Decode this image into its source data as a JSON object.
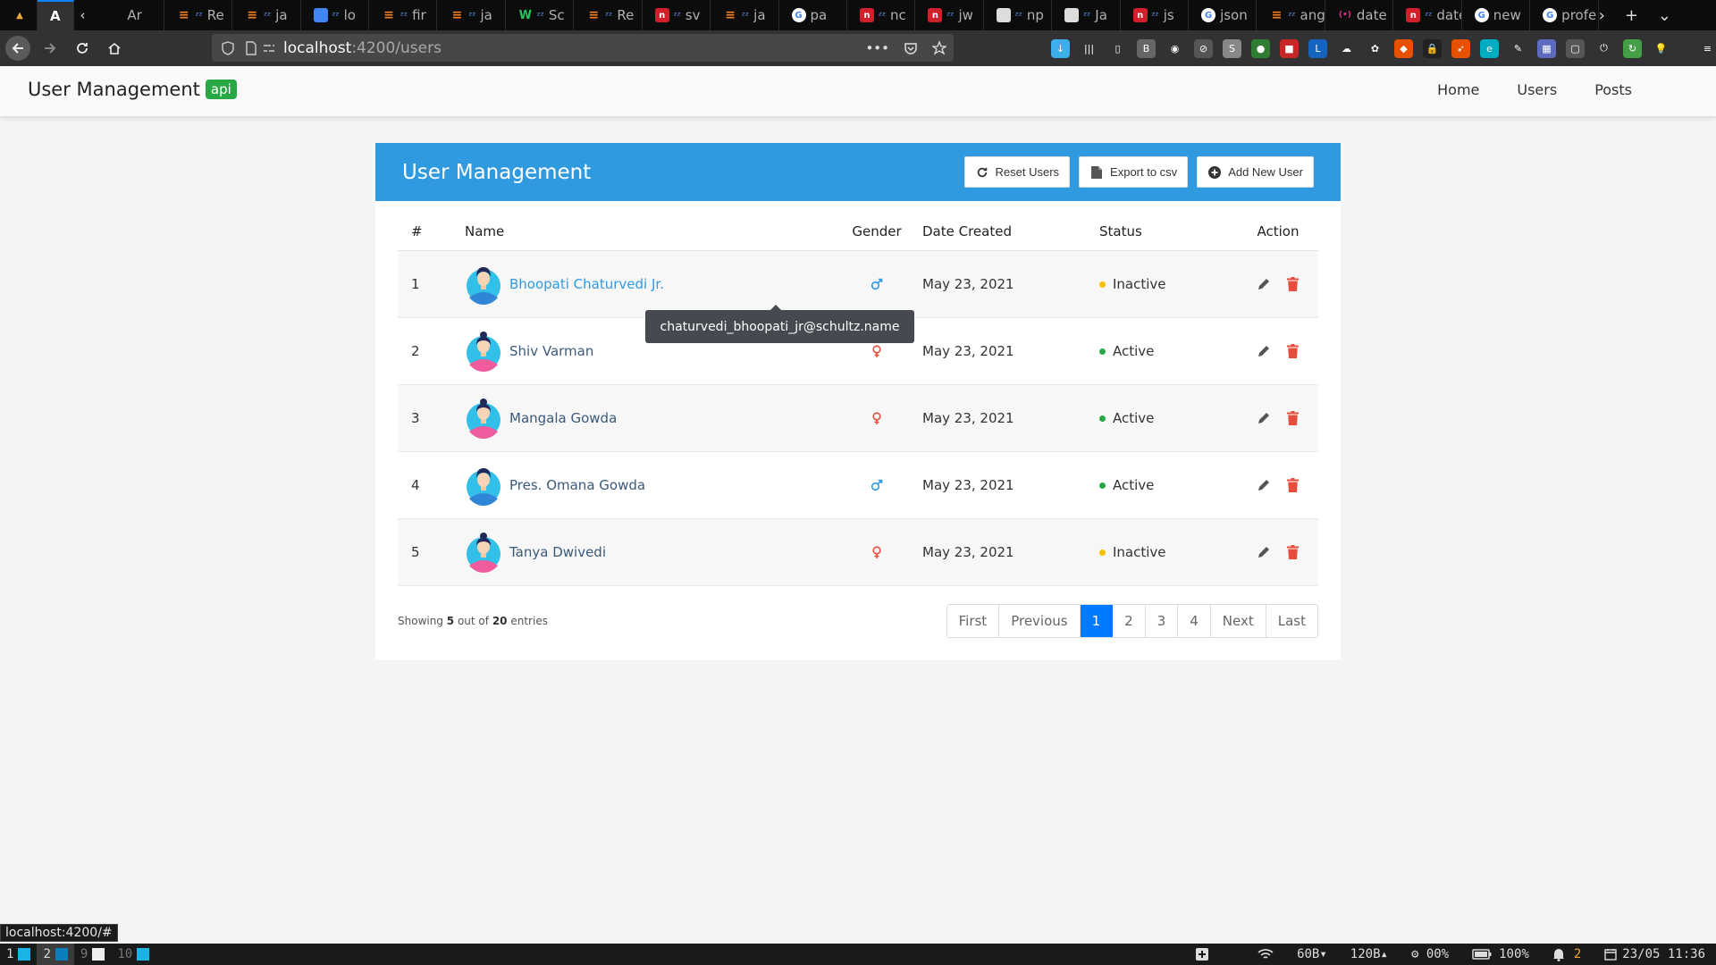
{
  "browser": {
    "tabs": [
      {
        "label": "",
        "icon": "angular-icon",
        "color": "#e44d26"
      },
      {
        "label": "",
        "icon": "angular-a-icon",
        "color": "#dd0031",
        "active": true
      },
      {
        "label": "Ar",
        "icon": "zz-icon"
      },
      {
        "label": "Re",
        "icon": "stack-overflow-icon"
      },
      {
        "label": "ja",
        "icon": "stack-overflow-icon"
      },
      {
        "label": "lo",
        "icon": "multicolor-icon"
      },
      {
        "label": "fir",
        "icon": "stack-overflow-icon"
      },
      {
        "label": "ja",
        "icon": "stack-overflow-icon"
      },
      {
        "label": "Sc",
        "icon": "w-icon"
      },
      {
        "label": "Re",
        "icon": "stack-overflow-icon"
      },
      {
        "label": "sv",
        "icon": "n-red-icon"
      },
      {
        "label": "ja",
        "icon": "stack-overflow-icon"
      },
      {
        "label": "pa",
        "icon": "google-icon"
      },
      {
        "label": "nc",
        "icon": "n-red-icon"
      },
      {
        "label": "jw",
        "icon": "n-red-icon"
      },
      {
        "label": "np",
        "icon": "doc-icon"
      },
      {
        "label": "Ja",
        "icon": "doc-icon"
      },
      {
        "label": "js",
        "icon": "n-red-icon"
      },
      {
        "label": "json",
        "icon": "google-icon"
      },
      {
        "label": "angu",
        "icon": "stack-overflow-icon"
      },
      {
        "label": "date",
        "icon": "braces-icon"
      },
      {
        "label": "date",
        "icon": "n-red-icon"
      },
      {
        "label": "new",
        "icon": "google-icon"
      },
      {
        "label": "profe",
        "icon": "google-icon"
      }
    ],
    "url_host": "localhost",
    "url_path": ":4200/users",
    "status_link": "localhost:4200/#"
  },
  "app": {
    "brand": "User Management",
    "brand_badge": "api",
    "nav": [
      "Home",
      "Users",
      "Posts"
    ]
  },
  "card": {
    "title": "User Management",
    "buttons": {
      "reset": "Reset Users",
      "export": "Export to csv",
      "add": "Add New User"
    },
    "headers": {
      "num": "#",
      "name": "Name",
      "gender": "Gender",
      "date": "Date Created",
      "status": "Status",
      "action": "Action"
    },
    "rows": [
      {
        "num": "1",
        "name": "Bhoopati Chaturvedi Jr.",
        "gender": "male",
        "date": "May 23, 2021",
        "status": "Inactive"
      },
      {
        "num": "2",
        "name": "Shiv Varman",
        "gender": "female",
        "date": "May 23, 2021",
        "status": "Active"
      },
      {
        "num": "3",
        "name": "Mangala Gowda",
        "gender": "female",
        "date": "May 23, 2021",
        "status": "Active"
      },
      {
        "num": "4",
        "name": "Pres. Omana Gowda",
        "gender": "male",
        "date": "May 23, 2021",
        "status": "Active"
      },
      {
        "num": "5",
        "name": "Tanya Dwivedi",
        "gender": "female",
        "date": "May 23, 2021",
        "status": "Inactive"
      }
    ],
    "tooltip": "chaturvedi_bhoopati_jr@schultz.name",
    "showing": {
      "prefix": "Showing",
      "count": "5",
      "middle": "out of",
      "total": "20",
      "suffix": "entries"
    },
    "pagination": [
      "First",
      "Previous",
      "1",
      "2",
      "3",
      "4",
      "Next",
      "Last"
    ],
    "active_page": "1"
  },
  "colors": {
    "header_blue": "#2f9ae0",
    "active": "#28a745",
    "inactive": "#f5c000",
    "male": "#2f9ae0",
    "female": "#e74c3c",
    "delete": "#e74c3c",
    "page_active": "#007bff"
  },
  "os_panel": {
    "workspaces": [
      "1",
      "2",
      "9",
      "10"
    ],
    "net_down": "60B▾",
    "net_up": "120B▴",
    "cpu": "00%",
    "battery": "100%",
    "notifications": "2",
    "datetime": "23/05 11:36"
  }
}
